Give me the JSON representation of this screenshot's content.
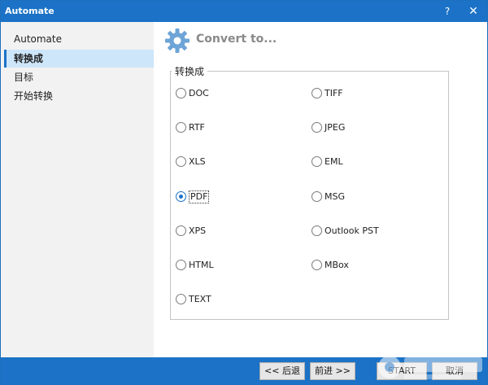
{
  "window": {
    "title": "Automate",
    "help_glyph": "?",
    "close_glyph": "✕"
  },
  "sidebar": {
    "items": [
      {
        "label": "Automate",
        "selected": false
      },
      {
        "label": "转换成",
        "selected": true
      },
      {
        "label": "目标",
        "selected": false
      },
      {
        "label": "开始转换",
        "selected": false
      }
    ]
  },
  "header": {
    "title": "Convert to...",
    "icon": "gear-icon"
  },
  "group": {
    "title": "转换成"
  },
  "options": [
    {
      "label": "DOC",
      "checked": false
    },
    {
      "label": "TIFF",
      "checked": false
    },
    {
      "label": "RTF",
      "checked": false
    },
    {
      "label": "JPEG",
      "checked": false
    },
    {
      "label": "XLS",
      "checked": false
    },
    {
      "label": "EML",
      "checked": false
    },
    {
      "label": "PDF",
      "checked": true
    },
    {
      "label": "MSG",
      "checked": false
    },
    {
      "label": "XPS",
      "checked": false
    },
    {
      "label": "Outlook PST",
      "checked": false
    },
    {
      "label": "HTML",
      "checked": false
    },
    {
      "label": "MBox",
      "checked": false
    },
    {
      "label": "TEXT",
      "checked": false
    }
  ],
  "footer": {
    "back_label": "<< 后退",
    "next_label": "前进 >>",
    "start_label": "START",
    "cancel_label": "取消"
  },
  "colors": {
    "accent": "#1b72c6",
    "sidebar_bg": "#f2f2f2",
    "selected_bg": "#cde6fa"
  }
}
